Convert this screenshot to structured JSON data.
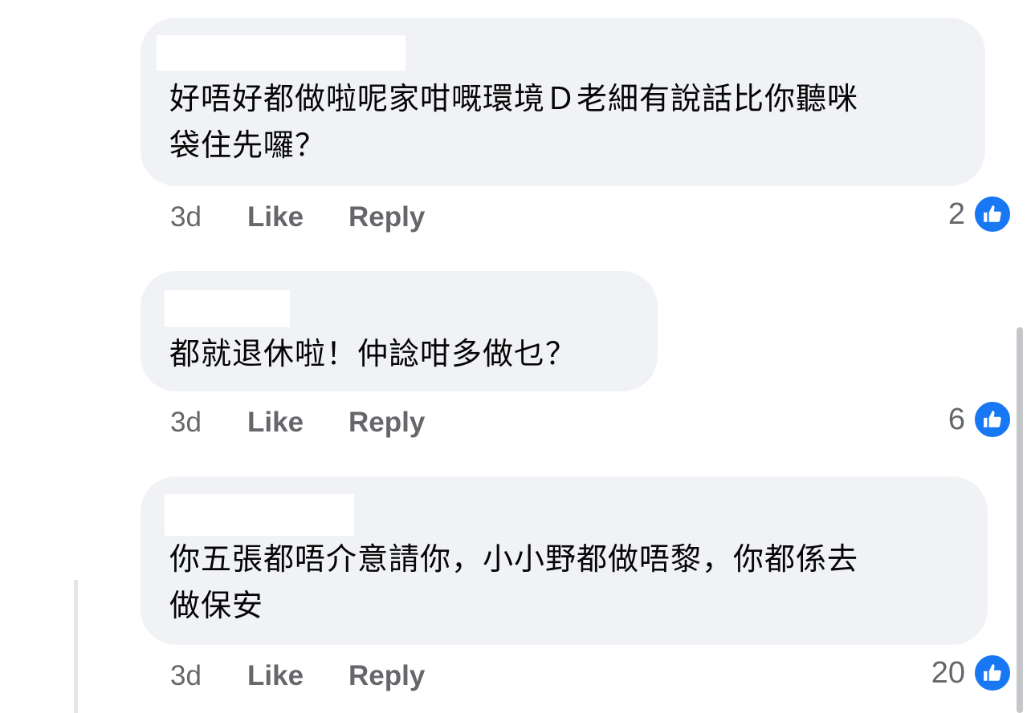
{
  "accent_color": "#1877f2",
  "comments": [
    {
      "text": "好唔好都做啦呢家咁嘅環境Ｄ老細有說話比你聽咪\n袋住先囉？",
      "time": "3d",
      "like_label": "Like",
      "reply_label": "Reply",
      "reaction_count": "2",
      "reaction_icon": "like-icon"
    },
    {
      "text": "都就退休啦！仲諗咁多做乜？",
      "time": "3d",
      "like_label": "Like",
      "reply_label": "Reply",
      "reaction_count": "6",
      "reaction_icon": "like-icon"
    },
    {
      "text": "你五張都唔介意請你，小小野都做唔黎，你都係去\n做保安",
      "time": "3d",
      "like_label": "Like",
      "reply_label": "Reply",
      "reaction_count": "20",
      "reaction_icon": "like-icon"
    }
  ]
}
